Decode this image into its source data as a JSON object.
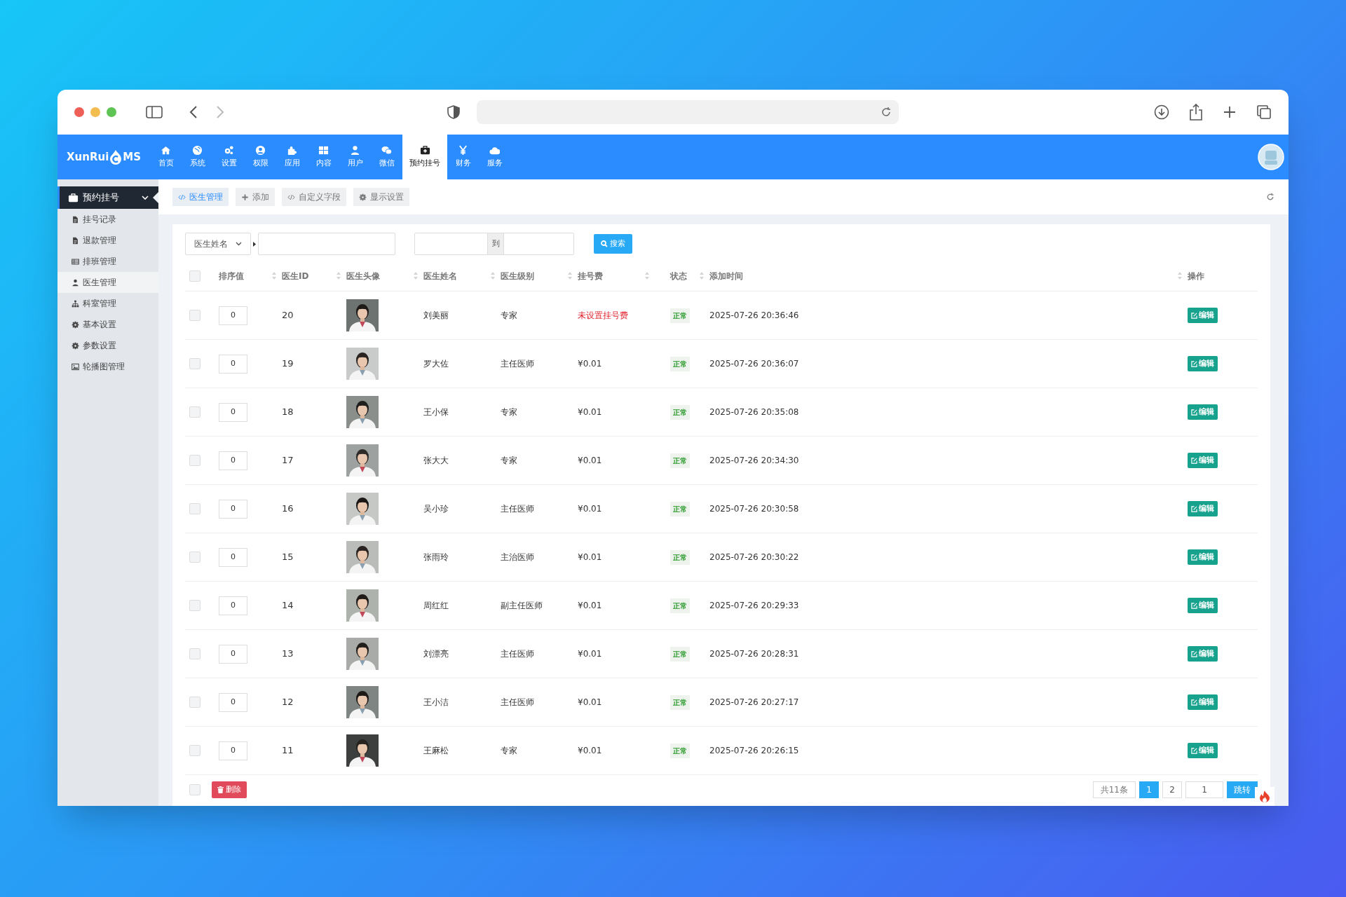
{
  "logo": {
    "text_before": "XunRui",
    "text_after": "MS"
  },
  "nav": [
    {
      "label": "首页",
      "selected": false
    },
    {
      "label": "系统",
      "selected": false
    },
    {
      "label": "设置",
      "selected": false
    },
    {
      "label": "权限",
      "selected": false
    },
    {
      "label": "应用",
      "selected": false
    },
    {
      "label": "内容",
      "selected": false
    },
    {
      "label": "用户",
      "selected": false
    },
    {
      "label": "微信",
      "selected": false
    },
    {
      "label": "预约挂号",
      "selected": true
    },
    {
      "label": "财务",
      "selected": false
    },
    {
      "label": "服务",
      "selected": false
    }
  ],
  "sidebar": {
    "header": "预约挂号",
    "expanded": true,
    "items": [
      {
        "label": "挂号记录",
        "selected": false
      },
      {
        "label": "退款管理",
        "selected": false
      },
      {
        "label": "排班管理",
        "selected": false
      },
      {
        "label": "医生管理",
        "selected": true
      },
      {
        "label": "科室管理",
        "selected": false
      },
      {
        "label": "基本设置",
        "selected": false
      },
      {
        "label": "参数设置",
        "selected": false
      },
      {
        "label": "轮播图管理",
        "selected": false
      }
    ]
  },
  "tabs": [
    {
      "label": "医生管理",
      "selected": true
    },
    {
      "label": "添加",
      "selected": false
    },
    {
      "label": "自定义字段",
      "selected": false
    },
    {
      "label": "显示设置",
      "selected": false
    }
  ],
  "search": {
    "field": "医生姓名",
    "range_separator": "到",
    "button": "搜索"
  },
  "table": {
    "all_checked": false,
    "columns": [
      "排序值",
      "医生ID",
      "医生头像",
      "医生姓名",
      "医生级别",
      "挂号费",
      "状态",
      "添加时间",
      "操作"
    ],
    "rows": [
      {
        "checked": false,
        "order": "0",
        "id": "20",
        "name": "刘美丽",
        "level": "专家",
        "fee": "未设置挂号费",
        "fee_missing": true,
        "status": "正常",
        "time": "2025-07-26 20:36:46",
        "action": "编辑"
      },
      {
        "checked": false,
        "order": "0",
        "id": "19",
        "name": "罗大佐",
        "level": "主任医师",
        "fee": "¥0.01",
        "fee_missing": false,
        "status": "正常",
        "time": "2025-07-26 20:36:07",
        "action": "编辑"
      },
      {
        "checked": false,
        "order": "0",
        "id": "18",
        "name": "王小保",
        "level": "专家",
        "fee": "¥0.01",
        "fee_missing": false,
        "status": "正常",
        "time": "2025-07-26 20:35:08",
        "action": "编辑"
      },
      {
        "checked": false,
        "order": "0",
        "id": "17",
        "name": "张大大",
        "level": "专家",
        "fee": "¥0.01",
        "fee_missing": false,
        "status": "正常",
        "time": "2025-07-26 20:34:30",
        "action": "编辑"
      },
      {
        "checked": false,
        "order": "0",
        "id": "16",
        "name": "吴小珍",
        "level": "主任医师",
        "fee": "¥0.01",
        "fee_missing": false,
        "status": "正常",
        "time": "2025-07-26 20:30:58",
        "action": "编辑"
      },
      {
        "checked": false,
        "order": "0",
        "id": "15",
        "name": "张雨玲",
        "level": "主治医师",
        "fee": "¥0.01",
        "fee_missing": false,
        "status": "正常",
        "time": "2025-07-26 20:30:22",
        "action": "编辑"
      },
      {
        "checked": false,
        "order": "0",
        "id": "14",
        "name": "周红红",
        "level": "副主任医师",
        "fee": "¥0.01",
        "fee_missing": false,
        "status": "正常",
        "time": "2025-07-26 20:29:33",
        "action": "编辑"
      },
      {
        "checked": false,
        "order": "0",
        "id": "13",
        "name": "刘漂亮",
        "level": "主任医师",
        "fee": "¥0.01",
        "fee_missing": false,
        "status": "正常",
        "time": "2025-07-26 20:28:31",
        "action": "编辑"
      },
      {
        "checked": false,
        "order": "0",
        "id": "12",
        "name": "王小洁",
        "level": "主任医师",
        "fee": "¥0.01",
        "fee_missing": false,
        "status": "正常",
        "time": "2025-07-26 20:27:17",
        "action": "编辑"
      },
      {
        "checked": false,
        "order": "0",
        "id": "11",
        "name": "王麻松",
        "level": "专家",
        "fee": "¥0.01",
        "fee_missing": false,
        "status": "正常",
        "time": "2025-07-26 20:26:15",
        "action": "编辑"
      }
    ]
  },
  "footer": {
    "all_checked": false,
    "delete": "删除",
    "total": "共11条",
    "pages": [
      {
        "label": "1",
        "selected": true
      },
      {
        "label": "2",
        "selected": false
      }
    ],
    "jump_value": "1",
    "jump": "跳转"
  }
}
